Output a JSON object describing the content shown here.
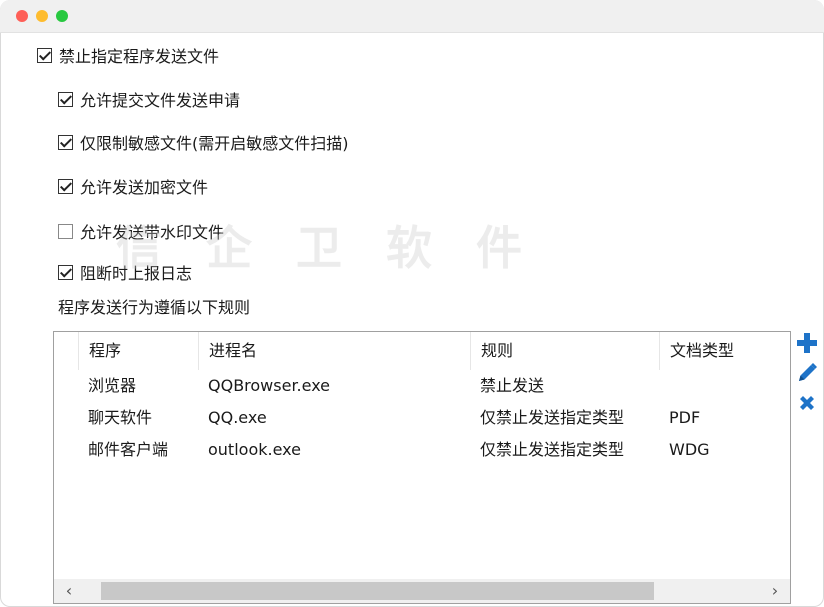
{
  "options": {
    "block_send": {
      "label": "禁止指定程序发送文件",
      "checked": true
    },
    "allow_submit": {
      "label": "允许提交文件发送申请",
      "checked": true
    },
    "sensitive_only": {
      "label": "仅限制敏感文件(需开启敏感文件扫描)",
      "checked": true
    },
    "allow_encrypted": {
      "label": "允许发送加密文件",
      "checked": true
    },
    "allow_watermark": {
      "label": "允许发送带水印文件",
      "checked": false
    },
    "report_log": {
      "label": "阻断时上报日志",
      "checked": true
    }
  },
  "rules_label": "程序发送行为遵循以下规则",
  "watermark_text": "信 企 卫 软 件",
  "table": {
    "headers": [
      "程序",
      "进程名",
      "规则",
      "文档类型"
    ],
    "rows": [
      [
        "浏览器",
        "QQBrowser.exe",
        "禁止发送",
        ""
      ],
      [
        "聊天软件",
        "QQ.exe",
        "仅禁止发送指定类型",
        "PDF"
      ],
      [
        "邮件客户端",
        "outlook.exe",
        "仅禁止发送指定类型",
        "WDG"
      ]
    ]
  },
  "scrollbar": {
    "left_arrow": "‹",
    "right_arrow": "›"
  },
  "icons": {
    "add": "plus-icon",
    "edit": "pencil-icon",
    "delete": "close-icon"
  },
  "colors": {
    "accent": "#1e73c8"
  }
}
